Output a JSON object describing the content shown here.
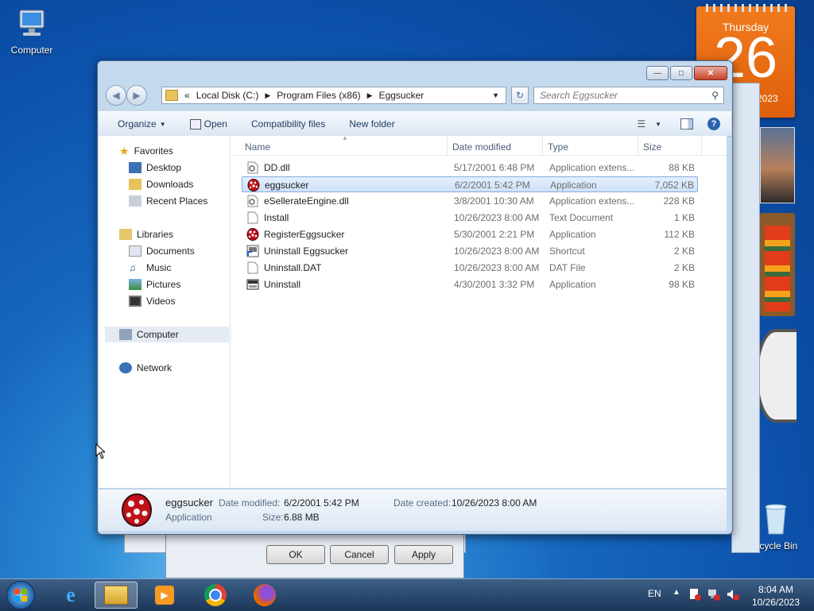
{
  "desktop": {
    "icons": [
      {
        "label": "Computer"
      },
      {
        "label": "ecycle Bin"
      }
    ],
    "calendar": {
      "weekday": "Thursday",
      "day": "26",
      "year": "2023"
    }
  },
  "window": {
    "address": {
      "overflow": "«",
      "crumbs": [
        "Local Disk (C:)",
        "Program Files (x86)",
        "Eggsucker"
      ]
    },
    "search_placeholder": "Search Eggsucker",
    "toolbar": {
      "organize": "Organize",
      "open": "Open",
      "compat": "Compatibility files",
      "new_folder": "New folder"
    },
    "nav": {
      "favorites": "Favorites",
      "fav_items": [
        "Desktop",
        "Downloads",
        "Recent Places"
      ],
      "libraries": "Libraries",
      "lib_items": [
        "Documents",
        "Music",
        "Pictures",
        "Videos"
      ],
      "computer": "Computer",
      "network": "Network"
    },
    "columns": [
      "Name",
      "Date modified",
      "Type",
      "Size"
    ],
    "files": [
      {
        "name": "DD.dll",
        "date": "5/17/2001 6:48 PM",
        "type": "Application extens...",
        "size": "88 KB",
        "icon": "dll-icon"
      },
      {
        "name": "eggsucker",
        "date": "6/2/2001 5:42 PM",
        "type": "Application",
        "size": "7,052 KB",
        "icon": "egg-app-icon",
        "selected": true
      },
      {
        "name": "eSellerateEngine.dll",
        "date": "3/8/2001 10:30 AM",
        "type": "Application extens...",
        "size": "228 KB",
        "icon": "dll-icon"
      },
      {
        "name": "Install",
        "date": "10/26/2023 8:00 AM",
        "type": "Text Document",
        "size": "1 KB",
        "icon": "text-icon"
      },
      {
        "name": "RegisterEggsucker",
        "date": "5/30/2001 2:21 PM",
        "type": "Application",
        "size": "112 KB",
        "icon": "egg-app-icon"
      },
      {
        "name": "Uninstall Eggsucker",
        "date": "10/26/2023 8:00 AM",
        "type": "Shortcut",
        "size": "2 KB",
        "icon": "shortcut-icon"
      },
      {
        "name": "Uninstall.DAT",
        "date": "10/26/2023 8:00 AM",
        "type": "DAT File",
        "size": "2 KB",
        "icon": "file-icon"
      },
      {
        "name": "Uninstall",
        "date": "4/30/2001 3:32 PM",
        "type": "Application",
        "size": "98 KB",
        "icon": "uninstall-app-icon"
      }
    ],
    "details": {
      "name": "eggsucker",
      "kind": "Application",
      "date_modified_label": "Date modified:",
      "date_modified": "6/2/2001 5:42 PM",
      "size_label": "Size:",
      "size": "6.88 MB",
      "date_created_label": "Date created:",
      "date_created": "10/26/2023 8:00 AM"
    }
  },
  "dialog": {
    "ok": "OK",
    "cancel": "Cancel",
    "apply": "Apply"
  },
  "taskbar": {
    "lang": "EN",
    "time": "8:04 AM",
    "date": "10/26/2023"
  }
}
